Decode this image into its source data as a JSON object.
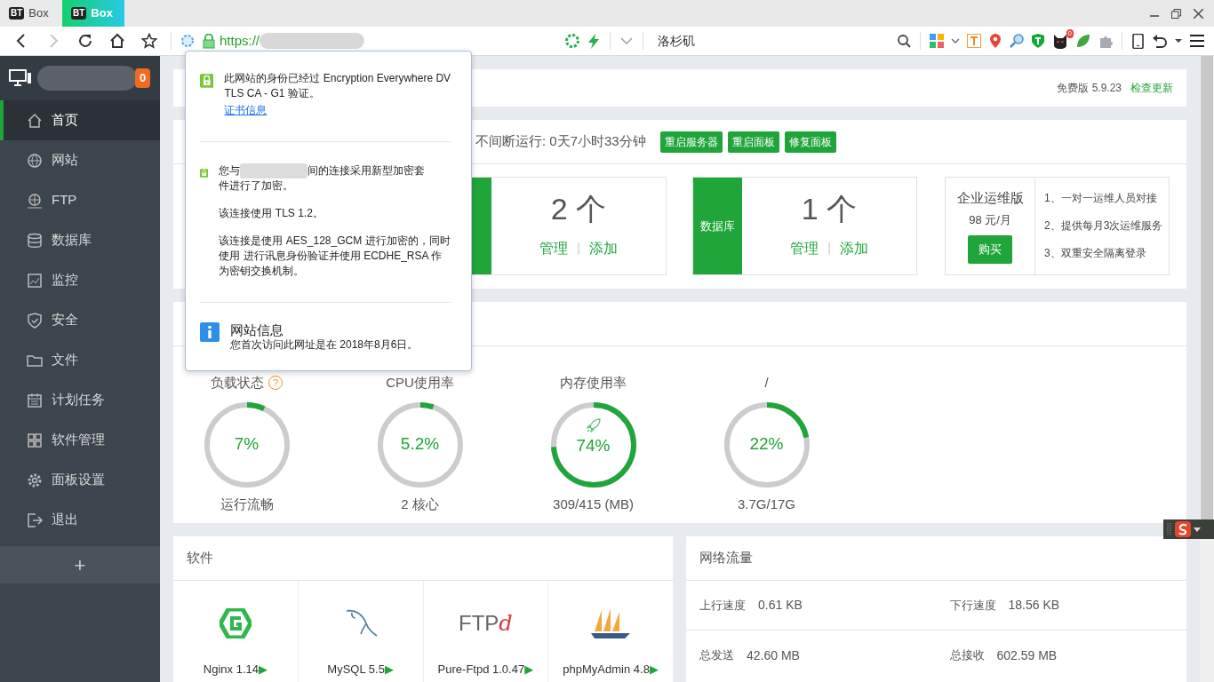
{
  "browser": {
    "tabs": [
      {
        "logo": "BT",
        "label": "Box",
        "selected": false
      },
      {
        "logo": "BT",
        "label": "Box",
        "selected": true
      }
    ],
    "forward_disabled": true,
    "scheme": "https://",
    "location": "洛杉矶",
    "extension_badge": "0"
  },
  "sidebar": {
    "badge": "0",
    "items": [
      {
        "label": "首页",
        "kind": "home",
        "selected": true
      },
      {
        "label": "网站",
        "kind": "globe",
        "selected": false
      },
      {
        "label": "FTP",
        "kind": "ftp",
        "selected": false
      },
      {
        "label": "数据库",
        "kind": "database",
        "selected": false
      },
      {
        "label": "监控",
        "kind": "monitor",
        "selected": false
      },
      {
        "label": "安全",
        "kind": "shield",
        "selected": false
      },
      {
        "label": "文件",
        "kind": "folder",
        "selected": false
      },
      {
        "label": "计划任务",
        "kind": "calendar",
        "selected": false
      },
      {
        "label": "软件管理",
        "kind": "grid",
        "selected": false
      },
      {
        "label": "面板设置",
        "kind": "gear",
        "selected": false
      },
      {
        "label": "退出",
        "kind": "exit",
        "selected": false
      }
    ],
    "add": "+"
  },
  "version_bar": {
    "version": "免费版 5.9.23",
    "update_link": "检查更新"
  },
  "status": {
    "uptime": "不间断运行: 0天7小时33分钟",
    "buttons": [
      "重启服务器",
      "重启面板",
      "修复面板"
    ]
  },
  "stat_cards": [
    {
      "count": "2 个",
      "manage": "管理",
      "separator": "|",
      "add": "添加"
    },
    {
      "label": "数据库",
      "count": "1 个",
      "manage": "管理",
      "separator": "|",
      "add": "添加"
    }
  ],
  "promo": {
    "title": "企业运维版",
    "price": "98 元/月",
    "buy": "购买",
    "features": [
      "1、一对一运维人员对接",
      "2、提供每月3次运维服务",
      "3、双重安全隔离登录"
    ]
  },
  "gauges": [
    {
      "title": "负载状态",
      "help": "?",
      "value": "7%",
      "level": 0.07,
      "caption": "运行流畅",
      "boost": false
    },
    {
      "title": "CPU使用率",
      "value": "5.2%",
      "level": 0.052,
      "caption": "2 核心",
      "boost": false
    },
    {
      "title": "内存使用率",
      "value": "74%",
      "level": 0.74,
      "caption": "309/415 (MB)",
      "boost": true
    },
    {
      "title": "/",
      "value": "22%",
      "level": 0.22,
      "caption": "3.7G/17G",
      "boost": false
    }
  ],
  "software": {
    "title": "软件",
    "items": [
      {
        "kind": "nginx",
        "name": "Nginx 1.14",
        "arrow": "▶"
      },
      {
        "kind": "mysql",
        "name": "MySQL 5.5",
        "arrow": "▶"
      },
      {
        "kind": "ftpd",
        "logo_text": "FTP",
        "logo_mark": "d",
        "name": "Pure-Ftpd 1.0.47",
        "arrow": "▶"
      },
      {
        "kind": "sailboat",
        "name": "phpMyAdmin 4.8",
        "arrow": "▶"
      }
    ]
  },
  "network": {
    "title": "网络流量",
    "stats": [
      {
        "label": "上行速度",
        "value": "0.61 KB"
      },
      {
        "label": "下行速度",
        "value": "18.56 KB"
      },
      {
        "label": "总发送",
        "value": "42.60 MB"
      },
      {
        "label": "总接收",
        "value": "602.59 MB"
      }
    ]
  },
  "popup": {
    "identity": "此网站的身份已经过 Encryption Everywhere DV TLS CA - G1 验证。",
    "cert_link": "证书信息",
    "connection_prefix": "您与",
    "connection_rest": "间的连接采用新型加密套",
    "connection_line2": "件进行了加密。",
    "paragraphs": [
      "该连接使用 TLS 1.2。",
      "该连接是使用 AES_128_GCM 进行加密的，同时使用  进行讯息身份验证并使用 ECDHE_RSA 作为密钥交换机制。"
    ],
    "info_title": "网站信息",
    "info_text": "您首次访问此网址是在 2018年8月6日。"
  }
}
